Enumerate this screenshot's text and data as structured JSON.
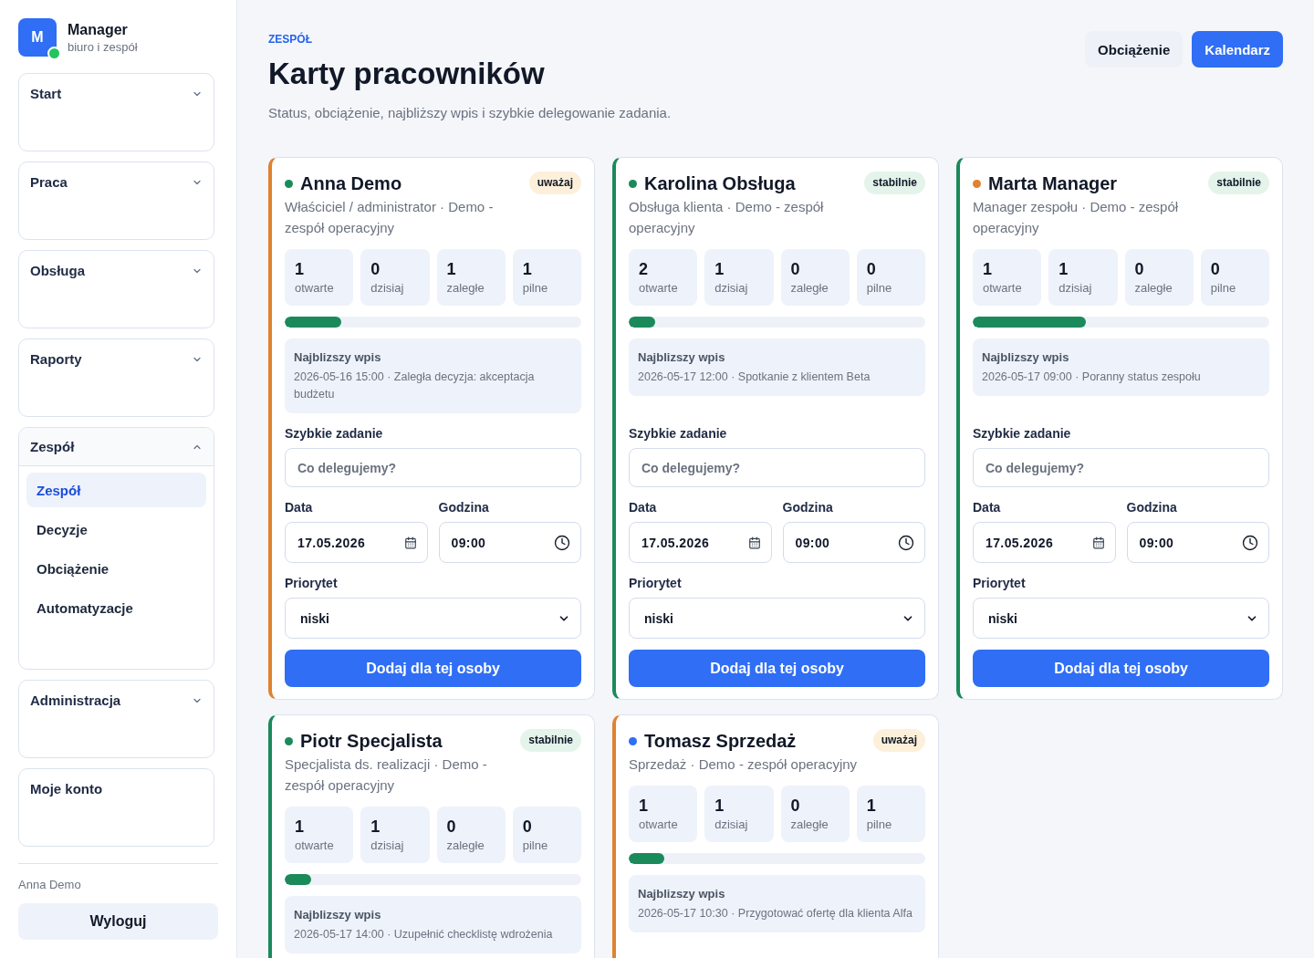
{
  "sidebar": {
    "brand": {
      "logo": "M",
      "name": "Manager",
      "subtitle": "biuro i zespół"
    },
    "groups": [
      {
        "kind": "group",
        "label": "Start",
        "expanded": false
      },
      {
        "kind": "group",
        "label": "Praca",
        "expanded": false
      },
      {
        "kind": "group",
        "label": "Obsługa",
        "expanded": false
      },
      {
        "kind": "group",
        "label": "Raporty",
        "expanded": false
      },
      {
        "kind": "group",
        "label": "Zespół",
        "expanded": true,
        "items": [
          {
            "label": "Zespół",
            "selected": true
          },
          {
            "label": "Decyzje",
            "selected": false
          },
          {
            "label": "Obciążenie",
            "selected": false
          },
          {
            "label": "Automatyzacje",
            "selected": false
          }
        ]
      },
      {
        "kind": "group",
        "label": "Administracja",
        "expanded": false
      },
      {
        "kind": "link",
        "label": "Moje konto"
      }
    ],
    "user": "Anna Demo",
    "logout": "Wyloguj"
  },
  "header": {
    "eyebrow": "ZESPÓŁ",
    "title": "Karty pracowników",
    "subtitle": "Status, obciążenie, najbliższy wpis i szybkie delegowanie zadania.",
    "actions": [
      {
        "label": "Obciążenie",
        "kind": "secondary"
      },
      {
        "label": "Kalendarz",
        "kind": "primary"
      }
    ]
  },
  "employees": [
    {
      "name": "Anna Demo",
      "color": "#1b8a5a",
      "role": "Właściciel / administrator · Demo - zespół operacyjny",
      "status": {
        "label": "uważaj",
        "kind": "warning"
      },
      "stats": [
        {
          "value": "1",
          "label": "otwarte"
        },
        {
          "value": "0",
          "label": "dzisiaj"
        },
        {
          "value": "1",
          "label": "zaległe"
        },
        {
          "value": "1",
          "label": "pilne"
        }
      ],
      "load": {
        "level": 0.19
      },
      "next": {
        "title": "Najblizszy wpis",
        "text": "2026-05-16 15:00 · Zaległa decyzja: akceptacja budżetu"
      },
      "quick_task": {
        "title": "Szybkie zadanie",
        "task": {
          "placeholder": "Co delegujemy?"
        },
        "date": {
          "label": "Data",
          "value": "17.05.2026"
        },
        "time": {
          "label": "Godzina",
          "value": "09:00"
        },
        "priority": {
          "label": "Priorytet",
          "value": "niski"
        },
        "submit": "Dodaj dla tej osoby"
      }
    },
    {
      "name": "Karolina Obsługa",
      "color": "#1b8a5a",
      "role": "Obsługa klienta · Demo - zespół operacyjny",
      "status": {
        "label": "stabilnie",
        "kind": "stable"
      },
      "stats": [
        {
          "value": "2",
          "label": "otwarte"
        },
        {
          "value": "1",
          "label": "dzisiaj"
        },
        {
          "value": "0",
          "label": "zaległe"
        },
        {
          "value": "0",
          "label": "pilne"
        }
      ],
      "load": {
        "level": 0.09
      },
      "next": {
        "title": "Najblizszy wpis",
        "text": "2026-05-17 12:00 · Spotkanie z klientem Beta"
      },
      "quick_task": {
        "title": "Szybkie zadanie",
        "task": {
          "placeholder": "Co delegujemy?"
        },
        "date": {
          "label": "Data",
          "value": "17.05.2026"
        },
        "time": {
          "label": "Godzina",
          "value": "09:00"
        },
        "priority": {
          "label": "Priorytet",
          "value": "niski"
        },
        "submit": "Dodaj dla tej osoby"
      }
    },
    {
      "name": "Marta Manager",
      "color": "#e0822f",
      "role": "Manager zespołu · Demo - zespół operacyjny",
      "status": {
        "label": "stabilnie",
        "kind": "stable"
      },
      "stats": [
        {
          "value": "1",
          "label": "otwarte"
        },
        {
          "value": "1",
          "label": "dzisiaj"
        },
        {
          "value": "0",
          "label": "zaległe"
        },
        {
          "value": "0",
          "label": "pilne"
        }
      ],
      "load": {
        "level": 0.38
      },
      "next": {
        "title": "Najblizszy wpis",
        "text": "2026-05-17 09:00 · Poranny status zespołu"
      },
      "quick_task": {
        "title": "Szybkie zadanie",
        "task": {
          "placeholder": "Co delegujemy?"
        },
        "date": {
          "label": "Data",
          "value": "17.05.2026"
        },
        "time": {
          "label": "Godzina",
          "value": "09:00"
        },
        "priority": {
          "label": "Priorytet",
          "value": "niski"
        },
        "submit": "Dodaj dla tej osoby"
      }
    },
    {
      "name": "Piotr Specjalista",
      "color": "#1b8a5a",
      "role": "Specjalista ds. realizacji · Demo - zespół operacyjny",
      "status": {
        "label": "stabilnie",
        "kind": "stable"
      },
      "stats": [
        {
          "value": "1",
          "label": "otwarte"
        },
        {
          "value": "1",
          "label": "dzisiaj"
        },
        {
          "value": "0",
          "label": "zaległe"
        },
        {
          "value": "0",
          "label": "pilne"
        }
      ],
      "load": {
        "level": 0.09
      },
      "next": {
        "title": "Najblizszy wpis",
        "text": "2026-05-17 14:00 · Uzupełnić checklistę wdrożenia"
      }
    },
    {
      "name": "Tomasz Sprzedaż",
      "color": "#2f6ef5",
      "role": "Sprzedaż · Demo - zespół operacyjny",
      "status": {
        "label": "uważaj",
        "kind": "warning"
      },
      "stats": [
        {
          "value": "1",
          "label": "otwarte"
        },
        {
          "value": "1",
          "label": "dzisiaj"
        },
        {
          "value": "0",
          "label": "zaległe"
        },
        {
          "value": "1",
          "label": "pilne"
        }
      ],
      "load": {
        "level": 0.12
      },
      "next": {
        "title": "Najblizszy wpis",
        "text": "2026-05-17 10:30 · Przygotować ofertę dla klienta Alfa"
      }
    }
  ]
}
